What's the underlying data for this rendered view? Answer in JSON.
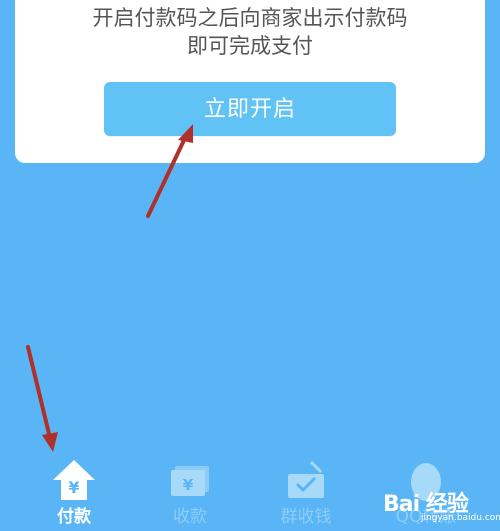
{
  "card": {
    "line1": "开启付款码之后向商家出示付款码",
    "line2": "即可完成支付",
    "button_label": "立即开启"
  },
  "tabs": [
    {
      "label": "付款",
      "icon": "yuan-home-icon",
      "active": true
    },
    {
      "label": "收款",
      "icon": "yuan-receipt-icon",
      "active": false
    },
    {
      "label": "群收钱",
      "icon": "envelope-check-icon",
      "active": false
    },
    {
      "label": "QQ转账",
      "icon": "penguin-icon",
      "active": false
    }
  ],
  "watermark": {
    "brand": "Bai 经验",
    "url": "jingyan.baidu.com"
  },
  "colors": {
    "background": "#5ab5f7",
    "button": "#61c3f5",
    "annotation_arrow": "#b0302a"
  }
}
